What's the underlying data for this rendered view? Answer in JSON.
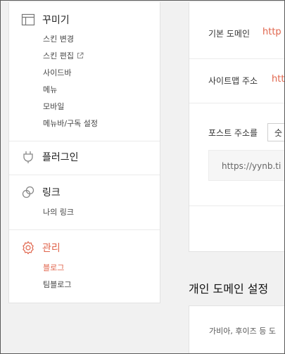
{
  "sidebar": {
    "sections": [
      {
        "label": "꾸미기",
        "icon": "layout-icon",
        "items": [
          {
            "label": "스킨 변경"
          },
          {
            "label": "스킨 편집",
            "external": true
          },
          {
            "label": "사이드바"
          },
          {
            "label": "메뉴"
          },
          {
            "label": "모바일"
          },
          {
            "label": "메뉴바/구독 설정"
          }
        ]
      },
      {
        "label": "플러그인",
        "icon": "plug-icon",
        "items": []
      },
      {
        "label": "링크",
        "icon": "link-icon",
        "items": [
          {
            "label": "나의 링크"
          }
        ]
      },
      {
        "label": "관리",
        "icon": "gear-icon",
        "active": true,
        "items": [
          {
            "label": "블로그",
            "active": true
          },
          {
            "label": "팀블로그"
          }
        ]
      }
    ]
  },
  "settings": {
    "default_domain_label": "기본 도메인",
    "default_domain_value": "http",
    "sitemap_label": "사이트맵 주소",
    "sitemap_value": "htt",
    "post_address_label": "포스트 주소를",
    "post_address_select": "숫",
    "post_address_preview": "https://yynb.ti"
  },
  "custom_domain": {
    "title": "개인 도메인 설정",
    "description": "가비아, 후이즈 등 도"
  },
  "colors": {
    "accent": "#e0644b",
    "background": "#f1f1f1"
  }
}
